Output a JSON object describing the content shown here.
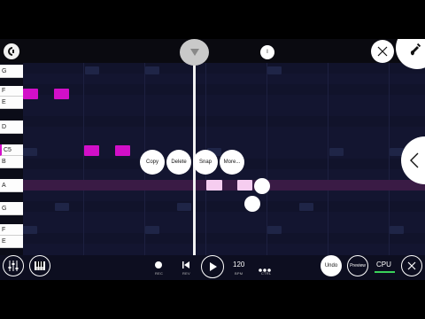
{
  "app": {
    "logo_icon": "cakewalk-logo-icon",
    "menu_badge": "I"
  },
  "piano_keys": [
    {
      "label": "G",
      "black": false
    },
    {
      "label": "F",
      "black": false
    },
    {
      "label": "E",
      "black": false
    },
    {
      "label": "D",
      "black": false
    },
    {
      "label": "C5",
      "black": false
    },
    {
      "label": "B",
      "black": false
    },
    {
      "label": "A",
      "black": false
    },
    {
      "label": "G",
      "black": false
    },
    {
      "label": "F",
      "black": false
    },
    {
      "label": "E",
      "black": false
    }
  ],
  "context_menu": {
    "copy": "Copy",
    "delete": "Delete",
    "snap": "Snap",
    "more": "More..."
  },
  "transport": {
    "rec_label": "REC",
    "rev_label": "REV",
    "bpm_value": "120",
    "bpm_label": "BPM",
    "ctrl_label": "CTRL"
  },
  "actions": {
    "undo": "Undo",
    "preview": "Preview",
    "cpu": "CPU"
  },
  "colors": {
    "note": "#d20fc8",
    "note_selected": "#f6cdf0",
    "grid_bg": "#131530",
    "cpu_meter": "#3ad15a"
  }
}
